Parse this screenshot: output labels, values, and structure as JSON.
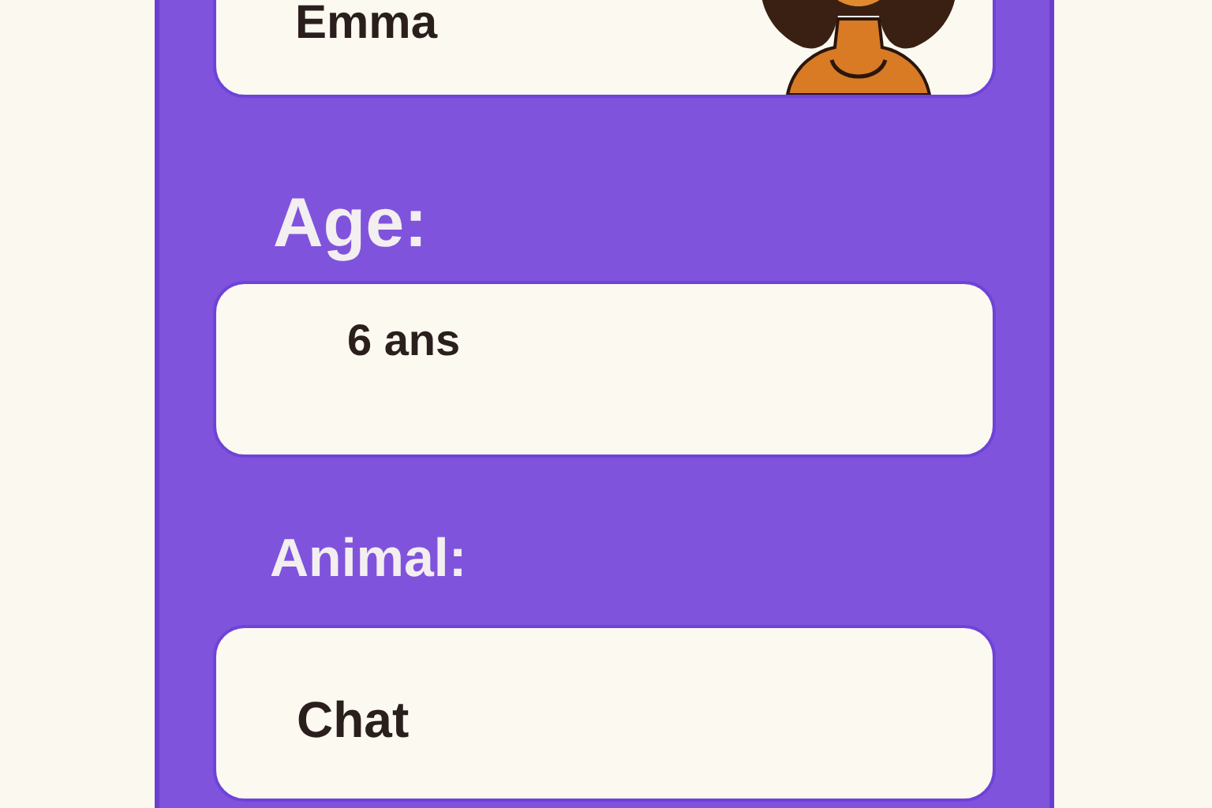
{
  "name_card": {
    "value": "Emma"
  },
  "fields": [
    {
      "label": "Age:",
      "value": "6 ans"
    },
    {
      "label": "Animal:",
      "value": "Chat"
    }
  ]
}
